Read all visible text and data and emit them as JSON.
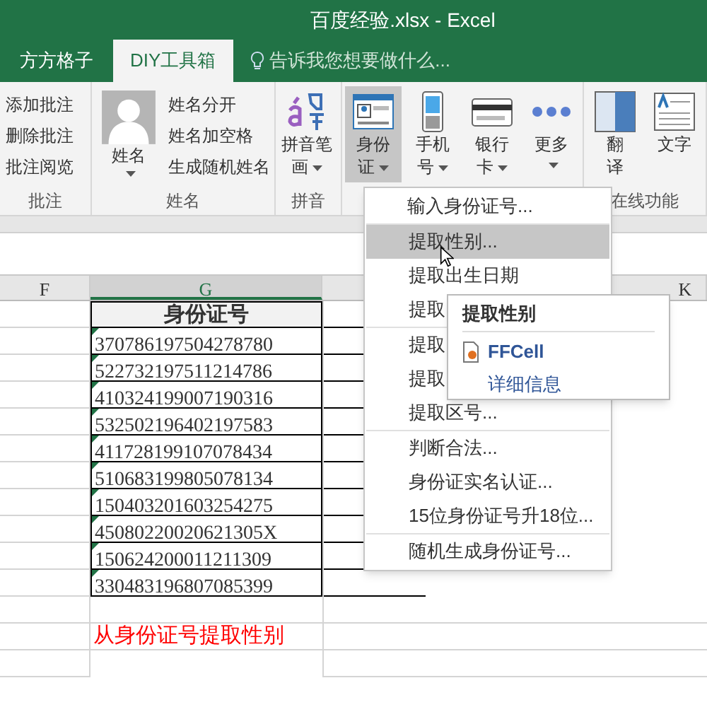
{
  "window": {
    "title": "百度经验.xlsx - Excel"
  },
  "tabs": [
    {
      "label": "方方格子",
      "selected": false
    },
    {
      "label": "DIY工具箱",
      "selected": true
    }
  ],
  "tell_me": {
    "label": "告诉我您想要做什么..."
  },
  "ribbon": {
    "groups": [
      {
        "label": "批注",
        "items": [
          {
            "kind": "small",
            "label": "添加批注"
          },
          {
            "kind": "small",
            "label": "删除批注"
          },
          {
            "kind": "small",
            "label": "批注阅览"
          }
        ]
      },
      {
        "label": "姓名",
        "items": [
          {
            "kind": "big",
            "lines": [
              "姓名"
            ],
            "caret": true,
            "selected": false
          },
          {
            "kind": "small",
            "label": "姓名分开"
          },
          {
            "kind": "small",
            "label": "姓名加空格"
          },
          {
            "kind": "small",
            "label": "生成随机姓名"
          }
        ]
      },
      {
        "label": "拼音",
        "items": [
          {
            "kind": "big",
            "lines": [
              "拼音笔",
              "画"
            ],
            "caret": true,
            "selected": false
          }
        ]
      },
      {
        "items": [
          {
            "kind": "big",
            "lines": [
              "身份",
              "证"
            ],
            "caret": true,
            "selected": true
          },
          {
            "kind": "big",
            "lines": [
              "手机",
              "号"
            ],
            "caret": true,
            "selected": false
          },
          {
            "kind": "big",
            "lines": [
              "银行",
              "卡"
            ],
            "caret": true,
            "selected": false
          },
          {
            "kind": "big",
            "lines": [
              "更多"
            ],
            "caret": true,
            "selected": false
          }
        ]
      },
      {
        "label": "在线功能",
        "items": [
          {
            "kind": "big",
            "lines": [
              "翻",
              "译"
            ],
            "caret": false,
            "selected": false
          },
          {
            "kind": "big",
            "lines": [
              "文字"
            ],
            "caret": false,
            "selected": false
          }
        ]
      }
    ]
  },
  "sheet": {
    "columns": [
      {
        "label": "F",
        "selected": false
      },
      {
        "label": "G",
        "selected": true
      },
      {
        "label": "K",
        "selected": false
      }
    ],
    "id_header": "身份证号",
    "ids": [
      "370786197504278780",
      "522732197511214786",
      "410324199007190316",
      "532502196402197583",
      "411728199107078434",
      "510683199805078134",
      "150403201603254275",
      "45080220020621305X",
      "150624200011211309",
      "330483196807085399"
    ],
    "note": "从身份证号提取性别"
  },
  "menu": {
    "sections": [
      [
        {
          "label": "输入身份证号...",
          "selected": false
        }
      ],
      [
        {
          "label": "提取性别...",
          "selected": true
        },
        {
          "label": "提取出生日期",
          "selected": false
        },
        {
          "label": "提取",
          "selected": false
        }
      ],
      [
        {
          "label": "提取",
          "selected": false
        },
        {
          "label": "提取",
          "selected": false
        },
        {
          "label": "提取区号...",
          "selected": false
        }
      ],
      [
        {
          "label": "判断合法...",
          "selected": false
        },
        {
          "label": "身份证实名认证...",
          "selected": false
        },
        {
          "label": "15位身份证号升18位...",
          "selected": false
        }
      ],
      [
        {
          "label": "随机生成身份证号...",
          "selected": false
        }
      ]
    ]
  },
  "tooltip": {
    "title": "提取性别",
    "app": "FFCell",
    "link": "详细信息"
  }
}
